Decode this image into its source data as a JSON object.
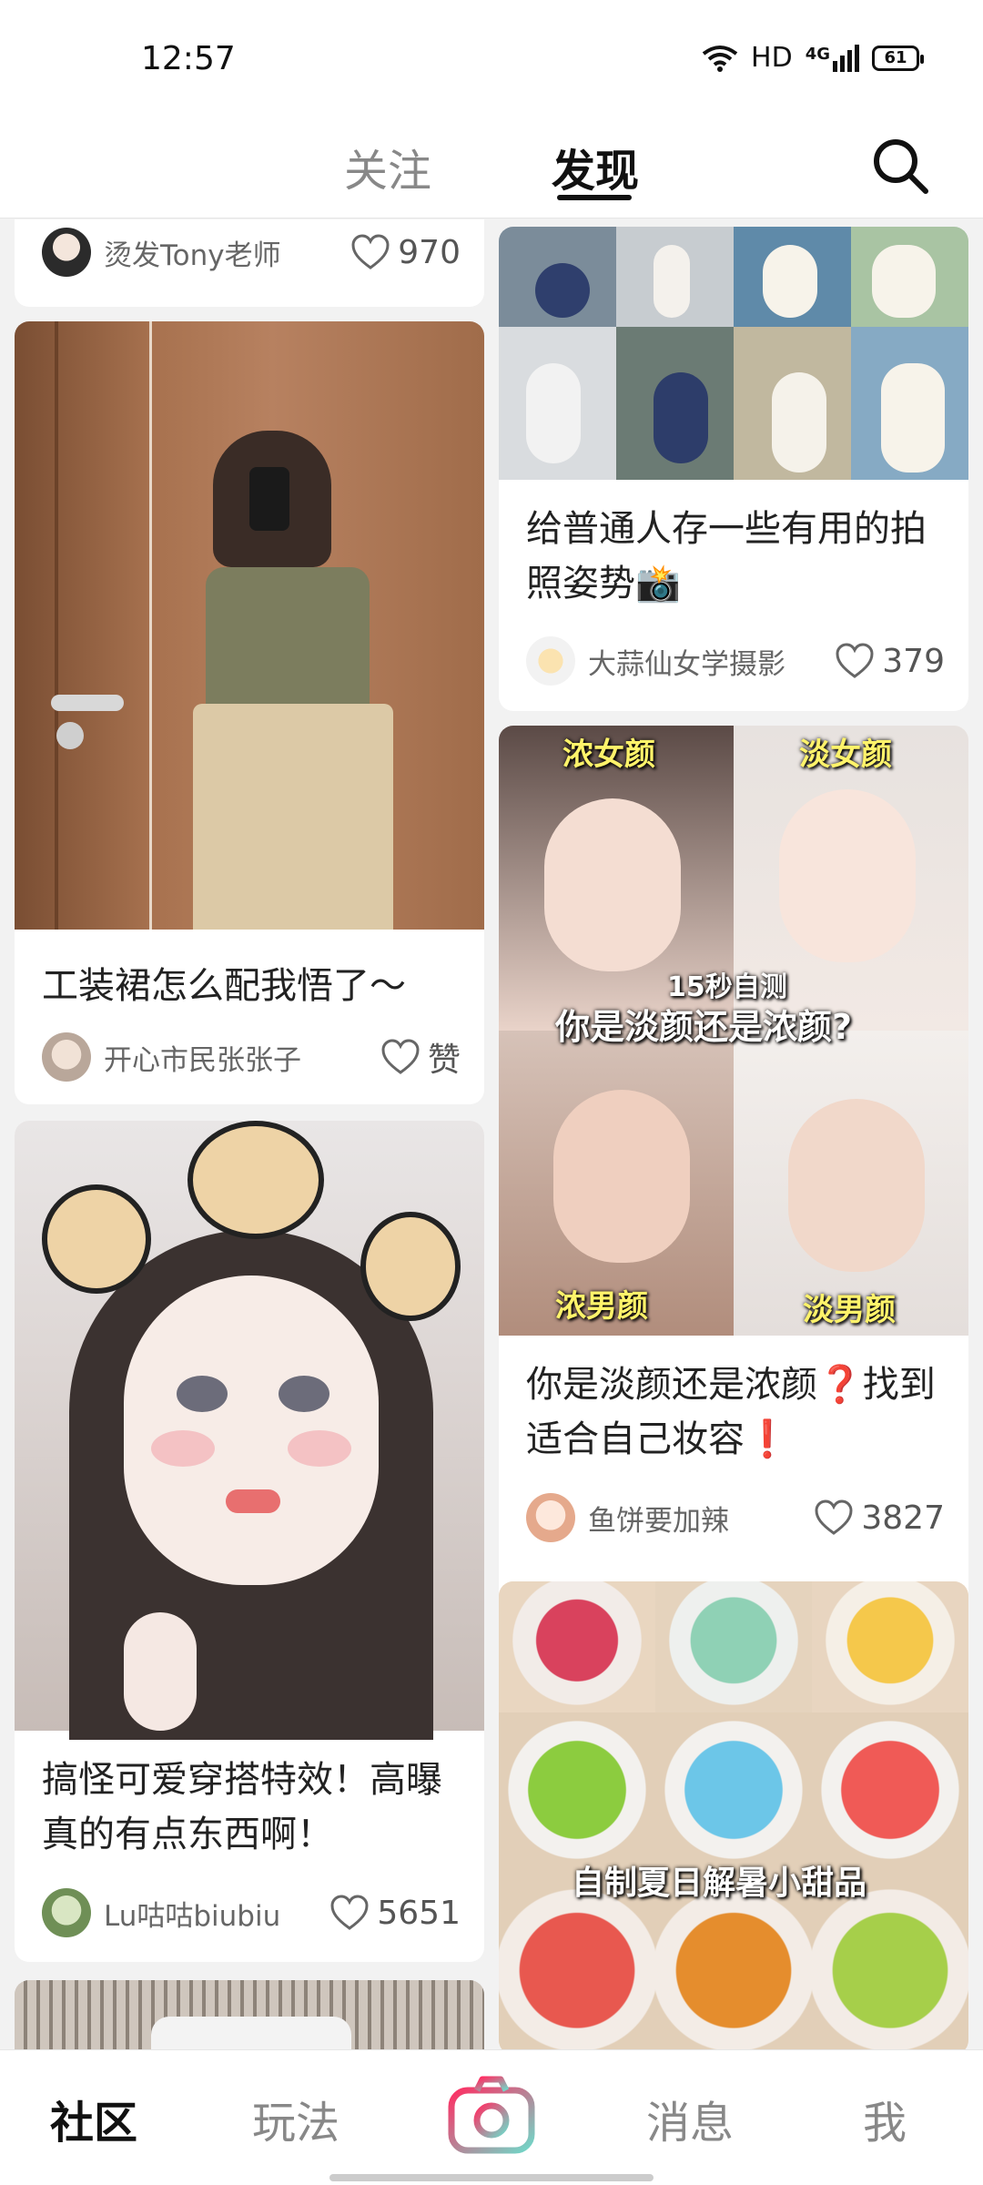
{
  "status_bar": {
    "time": "12:57",
    "network": "HD",
    "cellular": "4G",
    "battery": "61"
  },
  "top_nav": {
    "tabs": [
      {
        "label": "关注",
        "active": false
      },
      {
        "label": "发现",
        "active": true
      }
    ],
    "search_icon": "search-icon"
  },
  "feed": {
    "left": [
      {
        "author": "烫发Tony老师",
        "likes": "970"
      },
      {
        "title": "工装裙怎么配我悟了～",
        "author": "开心市民张张子",
        "likes": "赞"
      },
      {
        "title": "搞怪可爱穿搭特效！高曝真的有点东西啊！",
        "author": "Lu咕咕biubiu",
        "likes": "5651"
      }
    ],
    "right": [
      {
        "title": "给普通人存一些有用的拍照姿势📸",
        "author": "大蒜仙女学摄影",
        "likes": "379"
      },
      {
        "title": "你是淡颜还是浓颜❓找到适合自己妆容❗",
        "author": "鱼饼要加辣",
        "likes": "3827",
        "overlay": {
          "top_left": "浓女颜",
          "top_right": "淡女颜",
          "center_sub": "15秒自测",
          "center": "你是淡颜还是浓颜?",
          "bottom_left": "浓男颜",
          "bottom_right": "淡男颜"
        }
      },
      {
        "overlay": {
          "center": "自制夏日解暑小甜品"
        }
      }
    ]
  },
  "bottom_nav": {
    "items": [
      "社区",
      "玩法",
      "消息",
      "我"
    ],
    "active": "社区",
    "camera_icon": "camera-icon"
  },
  "colors": {
    "accent": "#ff2e63",
    "text": "#222222",
    "muted": "#888888"
  }
}
